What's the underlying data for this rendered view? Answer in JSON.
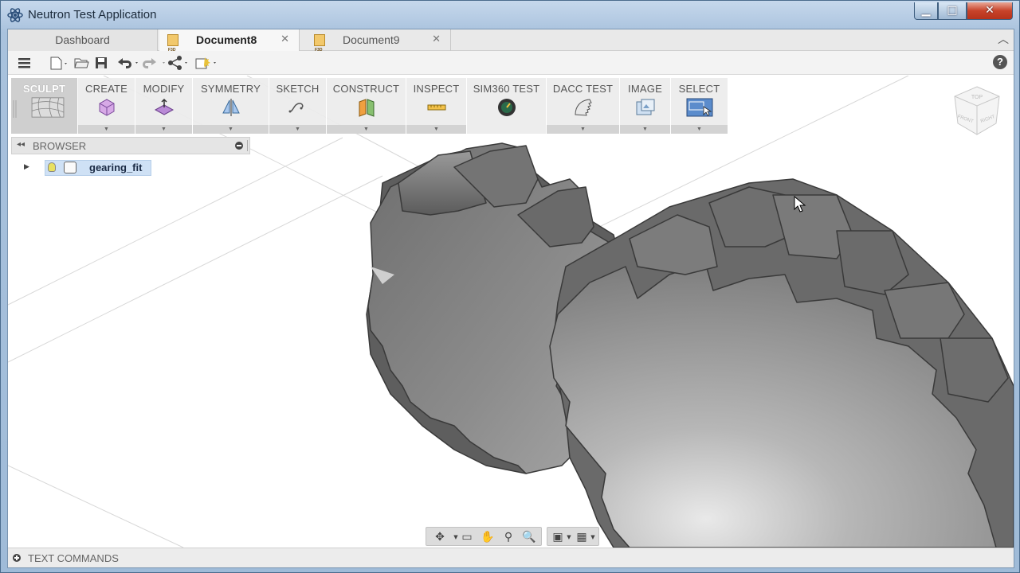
{
  "window": {
    "title": "Neutron Test Application",
    "minimize": "▁",
    "maximize": "□",
    "close": "✕"
  },
  "tabs": [
    {
      "label": "Dashboard"
    },
    {
      "label": "Document8",
      "close": "✕"
    },
    {
      "label": "Document9",
      "close": "✕"
    }
  ],
  "tabbar": {
    "collapse": "︿"
  },
  "qat": {
    "menu_icon": "menu-icon",
    "new_icon": "new-file-icon",
    "open_icon": "open-folder-icon",
    "save_icon": "save-icon",
    "undo_icon": "undo-icon",
    "redo_icon": "redo-icon",
    "share_icon": "share-icon",
    "publish_icon": "publish-icon",
    "help": "?"
  },
  "ribbon": [
    {
      "label": "SCULPT",
      "icon": "sculpt-mesh-icon"
    },
    {
      "label": "CREATE",
      "icon": "create-box-icon"
    },
    {
      "label": "MODIFY",
      "icon": "modify-icon"
    },
    {
      "label": "SYMMETRY",
      "icon": "symmetry-icon"
    },
    {
      "label": "SKETCH",
      "icon": "sketch-icon"
    },
    {
      "label": "CONSTRUCT",
      "icon": "construct-plane-icon"
    },
    {
      "label": "INSPECT",
      "icon": "measure-icon"
    },
    {
      "label": "SIM360 TEST",
      "icon": "sim360-icon"
    },
    {
      "label": "DACC TEST",
      "icon": "dacc-icon"
    },
    {
      "label": "IMAGE",
      "icon": "image-icon"
    },
    {
      "label": "SELECT",
      "icon": "select-icon"
    }
  ],
  "browser": {
    "title": "BROWSER",
    "collapse": "◂◂",
    "items": [
      {
        "name": "gearing_fit"
      }
    ]
  },
  "viewcube": {
    "top": "TOP",
    "front": "FRONT",
    "right": "RIGHT"
  },
  "navbar": {
    "orbit": "✥",
    "fit": "▭",
    "pan": "✋",
    "zoom_window": "⚲",
    "zoom": "🔍",
    "display": "▣",
    "grid": "▦"
  },
  "text_commands": {
    "label": "TEXT COMMANDS"
  },
  "colors": {
    "ribbon_bg": "#ebebeb",
    "selection": "#cfe1f5",
    "gear_face": "#8a8a8a",
    "titlebar": "#b6cde6"
  }
}
